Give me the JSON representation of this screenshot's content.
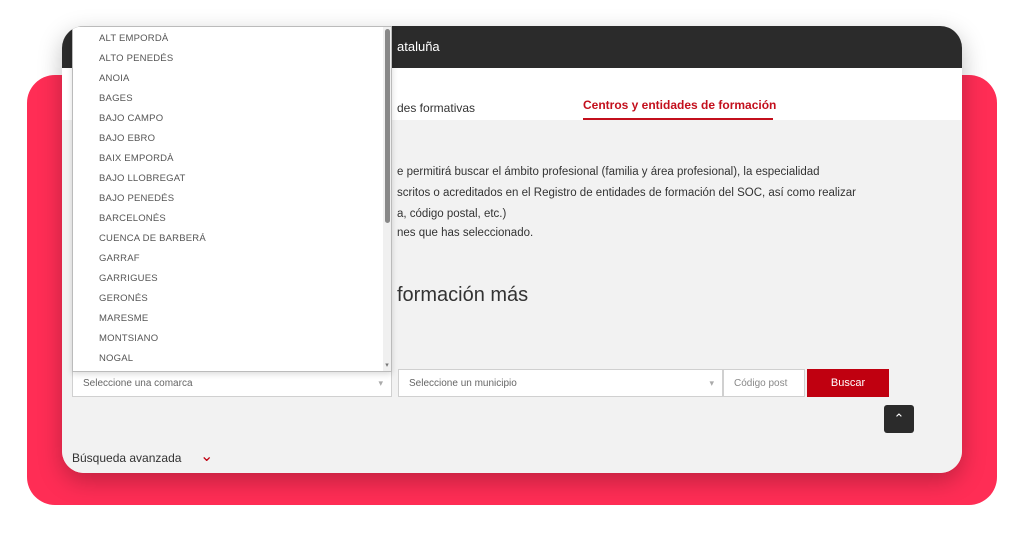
{
  "header": {
    "title_fragment": "ataluña"
  },
  "tabs": [
    {
      "label": "des formativas"
    },
    {
      "label": "Centros y entidades de formación"
    }
  ],
  "intro": {
    "line1": "e permitirá buscar el ámbito profesional (familia y área profesional), la especialidad",
    "line2": "scritos o acreditados en el Registro de entidades de formación del SOC, así como realizar",
    "line3": "a, código postal, etc.)",
    "line4": "nes que has seleccionado."
  },
  "heading": "formación más",
  "dropdown": {
    "options": [
      "ALT EMPORDÀ",
      "ALTO PENEDÉS",
      "ANOIA",
      "BAGES",
      "BAJO CAMPO",
      "BAJO EBRO",
      "BAIX EMPORDÀ",
      "BAJO LLOBREGAT",
      "BAJO PENEDÉS",
      "BARCELONÉS",
      "CUENCA DE BARBERÁ",
      "GARRAF",
      "GARRIGUES",
      "GERONÉS",
      "MARESME",
      "MONTSIANO",
      "NOGAL"
    ]
  },
  "form": {
    "comarca_placeholder": "Seleccione una comarca",
    "municipio_placeholder": "Seleccione un municipio",
    "postal_placeholder": "Código post",
    "search_label": "Buscar"
  },
  "advanced_search": {
    "label": "Búsqueda avanzada"
  },
  "icons": {
    "caret": "▾",
    "up": "⌃",
    "chevron": "⌄"
  },
  "colors": {
    "accent_red": "#c00010",
    "backdrop_pink": "#ff2d55",
    "topbar": "#2b2b2b"
  }
}
